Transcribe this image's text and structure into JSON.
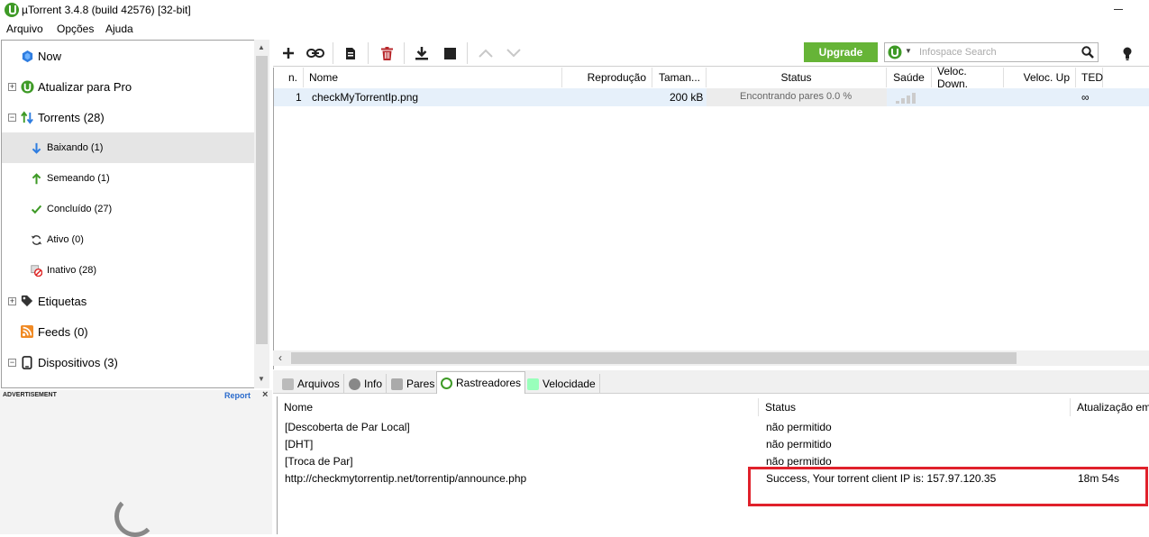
{
  "window": {
    "title": "µTorrent 3.4.8  (build 42576) [32-bit]"
  },
  "menu": {
    "items": [
      "Arquivo",
      "Opções",
      "Ajuda"
    ]
  },
  "sidebar": {
    "items": [
      {
        "label": "Now",
        "icon": "now-globe-icon"
      },
      {
        "label": "Atualizar para Pro",
        "icon": "utorrent-pro-icon"
      },
      {
        "label": "Torrents (28)",
        "icon": "torrents-updown-icon"
      },
      {
        "label": "Baixando (1)",
        "icon": "download-arrow-icon"
      },
      {
        "label": "Semeando (1)",
        "icon": "upload-arrow-icon"
      },
      {
        "label": "Concluído (27)",
        "icon": "checkmark-icon"
      },
      {
        "label": "Ativo (0)",
        "icon": "refresh-icon"
      },
      {
        "label": "Inativo (28)",
        "icon": "inactive-icon"
      },
      {
        "label": "Etiquetas",
        "icon": "tag-icon"
      },
      {
        "label": "Feeds (0)",
        "icon": "rss-icon"
      },
      {
        "label": "Dispositivos (3)",
        "icon": "phone-icon"
      }
    ]
  },
  "ad": {
    "label": "ADVERTISEMENT",
    "report": "Report",
    "close": "×"
  },
  "toolbar": {
    "upgrade": "Upgrade",
    "search_placeholder": "Infospace Search"
  },
  "torrent_list": {
    "columns": [
      "n.",
      "Nome",
      "Reprodução",
      "Taman...",
      "Status",
      "Saúde",
      "Veloc. Down.",
      "Veloc. Up",
      "TED"
    ],
    "rows": [
      {
        "n": "1",
        "name": "checkMyTorrentIp.png",
        "size": "200 kB",
        "status": "Encontrando pares 0.0 %",
        "eta": "∞"
      }
    ]
  },
  "tabs": {
    "items": [
      "Arquivos",
      "Info",
      "Pares",
      "Rastreadores",
      "Velocidade"
    ],
    "active": "Rastreadores"
  },
  "trackers": {
    "columns": [
      "Nome",
      "Status",
      "Atualização em"
    ],
    "rows": [
      {
        "name": "[Descoberta de Par Local]",
        "status": "não permitido",
        "update": ""
      },
      {
        "name": "[DHT]",
        "status": "não permitido",
        "update": ""
      },
      {
        "name": "[Troca de Par]",
        "status": "não permitido",
        "update": ""
      },
      {
        "name": "http://checkmytorrentip.net/torrentip/announce.php",
        "status": "Success, Your torrent client IP is: 157.97.120.35",
        "update": "18m 54s"
      }
    ]
  },
  "colors": {
    "accent_green": "#66b437",
    "highlight_red": "#e0212b",
    "selection": "#e5e5e5"
  }
}
